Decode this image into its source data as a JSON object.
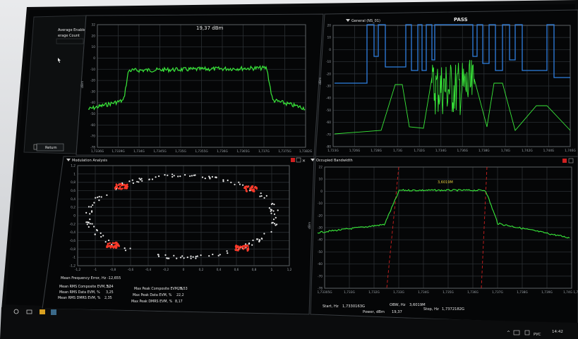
{
  "left_panel": {
    "average_enable": "Average Enable",
    "average_count": "erage Count",
    "return_button": "Return"
  },
  "spectrum_panel": {
    "title_fragment": "",
    "power_readout": "19,37 dBm",
    "y_ticks": [
      "32",
      "20",
      "10",
      "0",
      "-10",
      "-20",
      "-30",
      "-40",
      "-50",
      "-60",
      "-70",
      "-78"
    ],
    "x_ticks": [
      "1,7336G",
      "1,7339G",
      "1,734G",
      "1,7345G",
      "1,735G",
      "1,7355G",
      "1,736G",
      "1,7365G",
      "1,737G",
      "1,7375G",
      "1,7382G"
    ],
    "y_unit": "dBm",
    "trace_color": "#39e83a"
  },
  "mask_panel": {
    "title": "General (NS_01)",
    "status": "PASS",
    "y_ticks": [
      "20",
      "10",
      "0",
      "-10",
      "-20",
      "-30",
      "-40",
      "-50",
      "-60",
      "-70",
      "-80"
    ],
    "x_ticks": [
      "1,723G",
      "1,726G",
      "1,728G",
      "1,73G",
      "1,732G",
      "1,734G",
      "1,736G",
      "1,738G",
      "1,74G",
      "1,742G",
      "1,744G",
      "1,746G"
    ],
    "y_unit": "dBm",
    "mask_color": "#2f7fe0",
    "trace_color": "#39e83a"
  },
  "modulation_panel": {
    "title": "Modulation Analysis",
    "y_ticks": [
      "1,2",
      "1",
      "0,8",
      "0,6",
      "0,4",
      "0,2",
      "0",
      "-0,2",
      "-0,4",
      "-0,6",
      "-0,8",
      "-1",
      "-1,2"
    ],
    "x_ticks": [
      "-1,2",
      "-1",
      "-0,8",
      "-0,6",
      "-0,4",
      "-0,2",
      "0",
      "0,2",
      "0,4",
      "0,6",
      "0,8",
      "1",
      "1,2"
    ],
    "mean_freq_label": "Mean Frequency Error, Hz",
    "mean_freq_value": "-12,655",
    "stats_left": [
      {
        "label": "Mean RMS Composite EVM, %",
        "value": "3,34"
      },
      {
        "label": "Mean RMS Data EVM, %",
        "value": "3,25"
      },
      {
        "label": "Mean RMS DMRS EVM, %",
        "value": "2,35"
      }
    ],
    "stats_right": [
      {
        "label": "Max Peak Composite EVM, %",
        "value": "28,53"
      },
      {
        "label": "Max Peak Data EVM, %",
        "value": "22,2"
      },
      {
        "label": "Max Peak DMRS EVM, %",
        "value": "8,17"
      }
    ]
  },
  "obw_panel": {
    "title": "Occupied Bandwidth",
    "obw_marker": "3,6019M",
    "y_ticks": [
      "22",
      "10",
      "0",
      "-10",
      "-20",
      "-30",
      "-40",
      "-50",
      "-60",
      "-70",
      "-78"
    ],
    "x_ticks": [
      "1,73305G",
      "1,733G",
      "1,732G",
      "1,733G",
      "1,734G",
      "1,735G",
      "1,736G",
      "1,737G",
      "1,738G",
      "1,739G",
      "1,74G 1,74"
    ],
    "y_unit": "dBm",
    "start_label": "Start, Hz",
    "start_value": "1,7330163G",
    "obw_label": "OBW, Hz",
    "obw_value": "3,6019M",
    "power_label": "Power, dBm",
    "power_value": "19,37",
    "stop_label": "Stop, Hz",
    "stop_value": "1,7372182G",
    "trace_color": "#39e83a",
    "marker_color": "#d02020"
  },
  "taskbar": {
    "lang": "РУС",
    "time": "14:42"
  }
}
